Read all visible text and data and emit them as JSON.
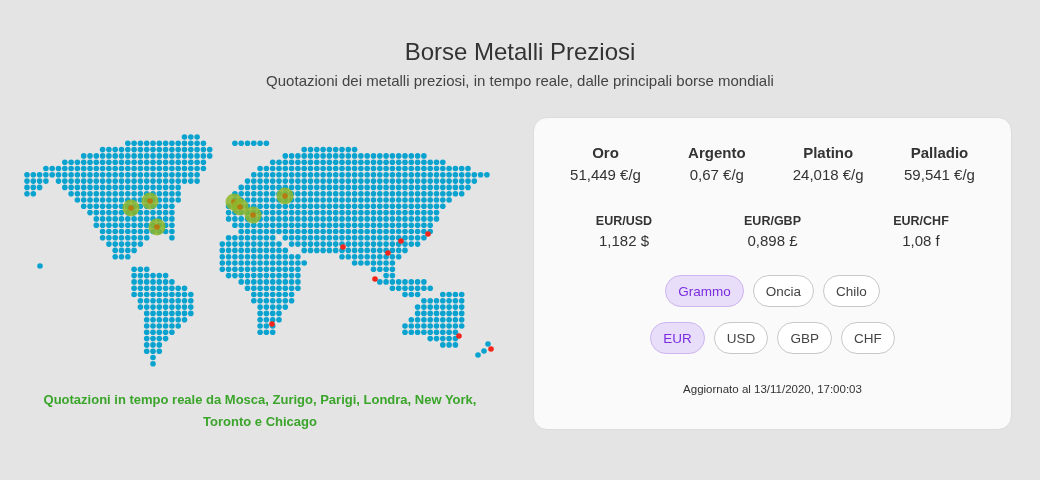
{
  "header": {
    "title": "Borse Metalli Preziosi",
    "subtitle": "Quotazioni dei metalli preziosi, in tempo reale, dalle principali borse mondiali"
  },
  "map": {
    "caption": "Quotazioni in tempo reale da Mosca, Zurigo, Parigi, Londra, New York, Toronto e Chicago"
  },
  "metals": [
    {
      "name": "Oro",
      "price": "51,449 €/g"
    },
    {
      "name": "Argento",
      "price": "0,67 €/g"
    },
    {
      "name": "Platino",
      "price": "24,018 €/g"
    },
    {
      "name": "Palladio",
      "price": "59,541 €/g"
    }
  ],
  "rates": [
    {
      "pair": "EUR/USD",
      "value": "1,182 $"
    },
    {
      "pair": "EUR/GBP",
      "value": "0,898 £"
    },
    {
      "pair": "EUR/CHF",
      "value": "1,08 f"
    }
  ],
  "units": [
    {
      "label": "Grammo",
      "selected": true
    },
    {
      "label": "Oncia",
      "selected": false
    },
    {
      "label": "Chilo",
      "selected": false
    }
  ],
  "currencies": [
    {
      "label": "EUR",
      "selected": true
    },
    {
      "label": "USD",
      "selected": false
    },
    {
      "label": "GBP",
      "selected": false
    },
    {
      "label": "CHF",
      "selected": false
    }
  ],
  "updated": "Aggiornato al 13/11/2020, 17:00:03"
}
